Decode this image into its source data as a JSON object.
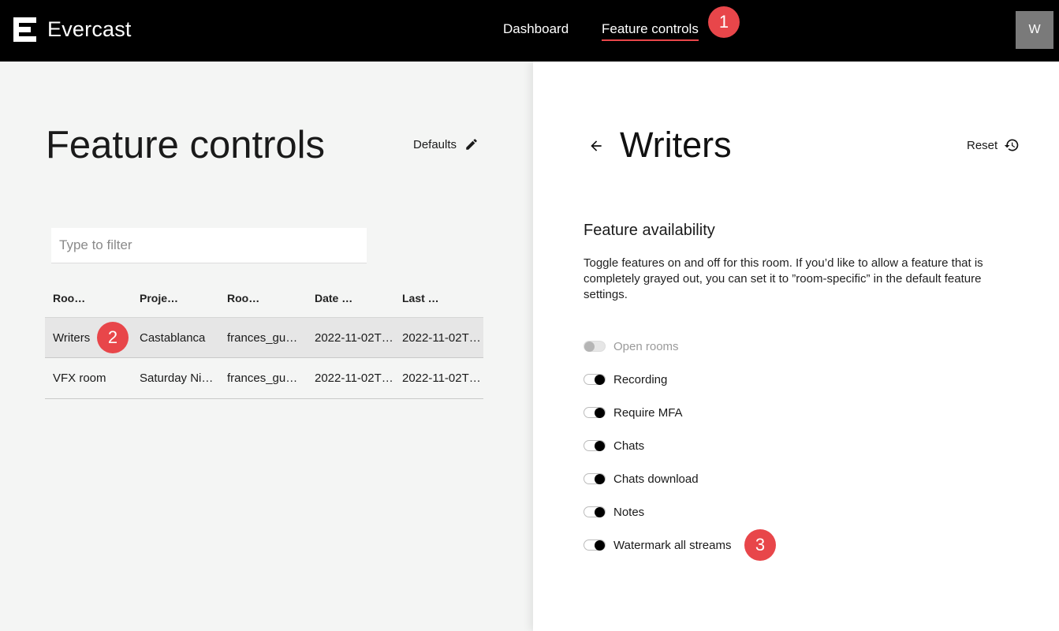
{
  "header": {
    "brand": "Evercast",
    "nav": [
      {
        "label": "Dashboard",
        "active": false
      },
      {
        "label": "Feature controls",
        "active": true
      }
    ],
    "avatar_initial": "W",
    "accent_color": "#e8464a"
  },
  "callouts": [
    "1",
    "2",
    "3"
  ],
  "left": {
    "title": "Feature controls",
    "defaults_label": "Defaults",
    "filter_placeholder": "Type to filter",
    "table": {
      "columns": [
        "Roo…",
        "Proje…",
        "Roo…",
        "Date …",
        "Last …"
      ],
      "rows": [
        {
          "cells": [
            "Writers",
            "Castablanca",
            "frances_gu…",
            "2022-11-02T…",
            "2022-11-02T…"
          ],
          "selected": true
        },
        {
          "cells": [
            "VFX room",
            "Saturday Ni…",
            "frances_gu…",
            "2022-11-02T…",
            "2022-11-02T…"
          ],
          "selected": false
        }
      ]
    }
  },
  "right": {
    "title": "Writers",
    "reset_label": "Reset",
    "section_title": "Feature availability",
    "section_desc": "Toggle features on and off for this room. If you’d like to allow a feature that is completely grayed out, you can set it to ”room-specific” in the default feature settings.",
    "toggles": [
      {
        "label": "Open rooms",
        "on": false,
        "disabled": true
      },
      {
        "label": "Recording",
        "on": true,
        "disabled": false
      },
      {
        "label": "Require MFA",
        "on": true,
        "disabled": false
      },
      {
        "label": "Chats",
        "on": true,
        "disabled": false
      },
      {
        "label": "Chats download",
        "on": true,
        "disabled": false
      },
      {
        "label": "Notes",
        "on": true,
        "disabled": false
      },
      {
        "label": "Watermark all streams",
        "on": true,
        "disabled": false
      }
    ]
  }
}
